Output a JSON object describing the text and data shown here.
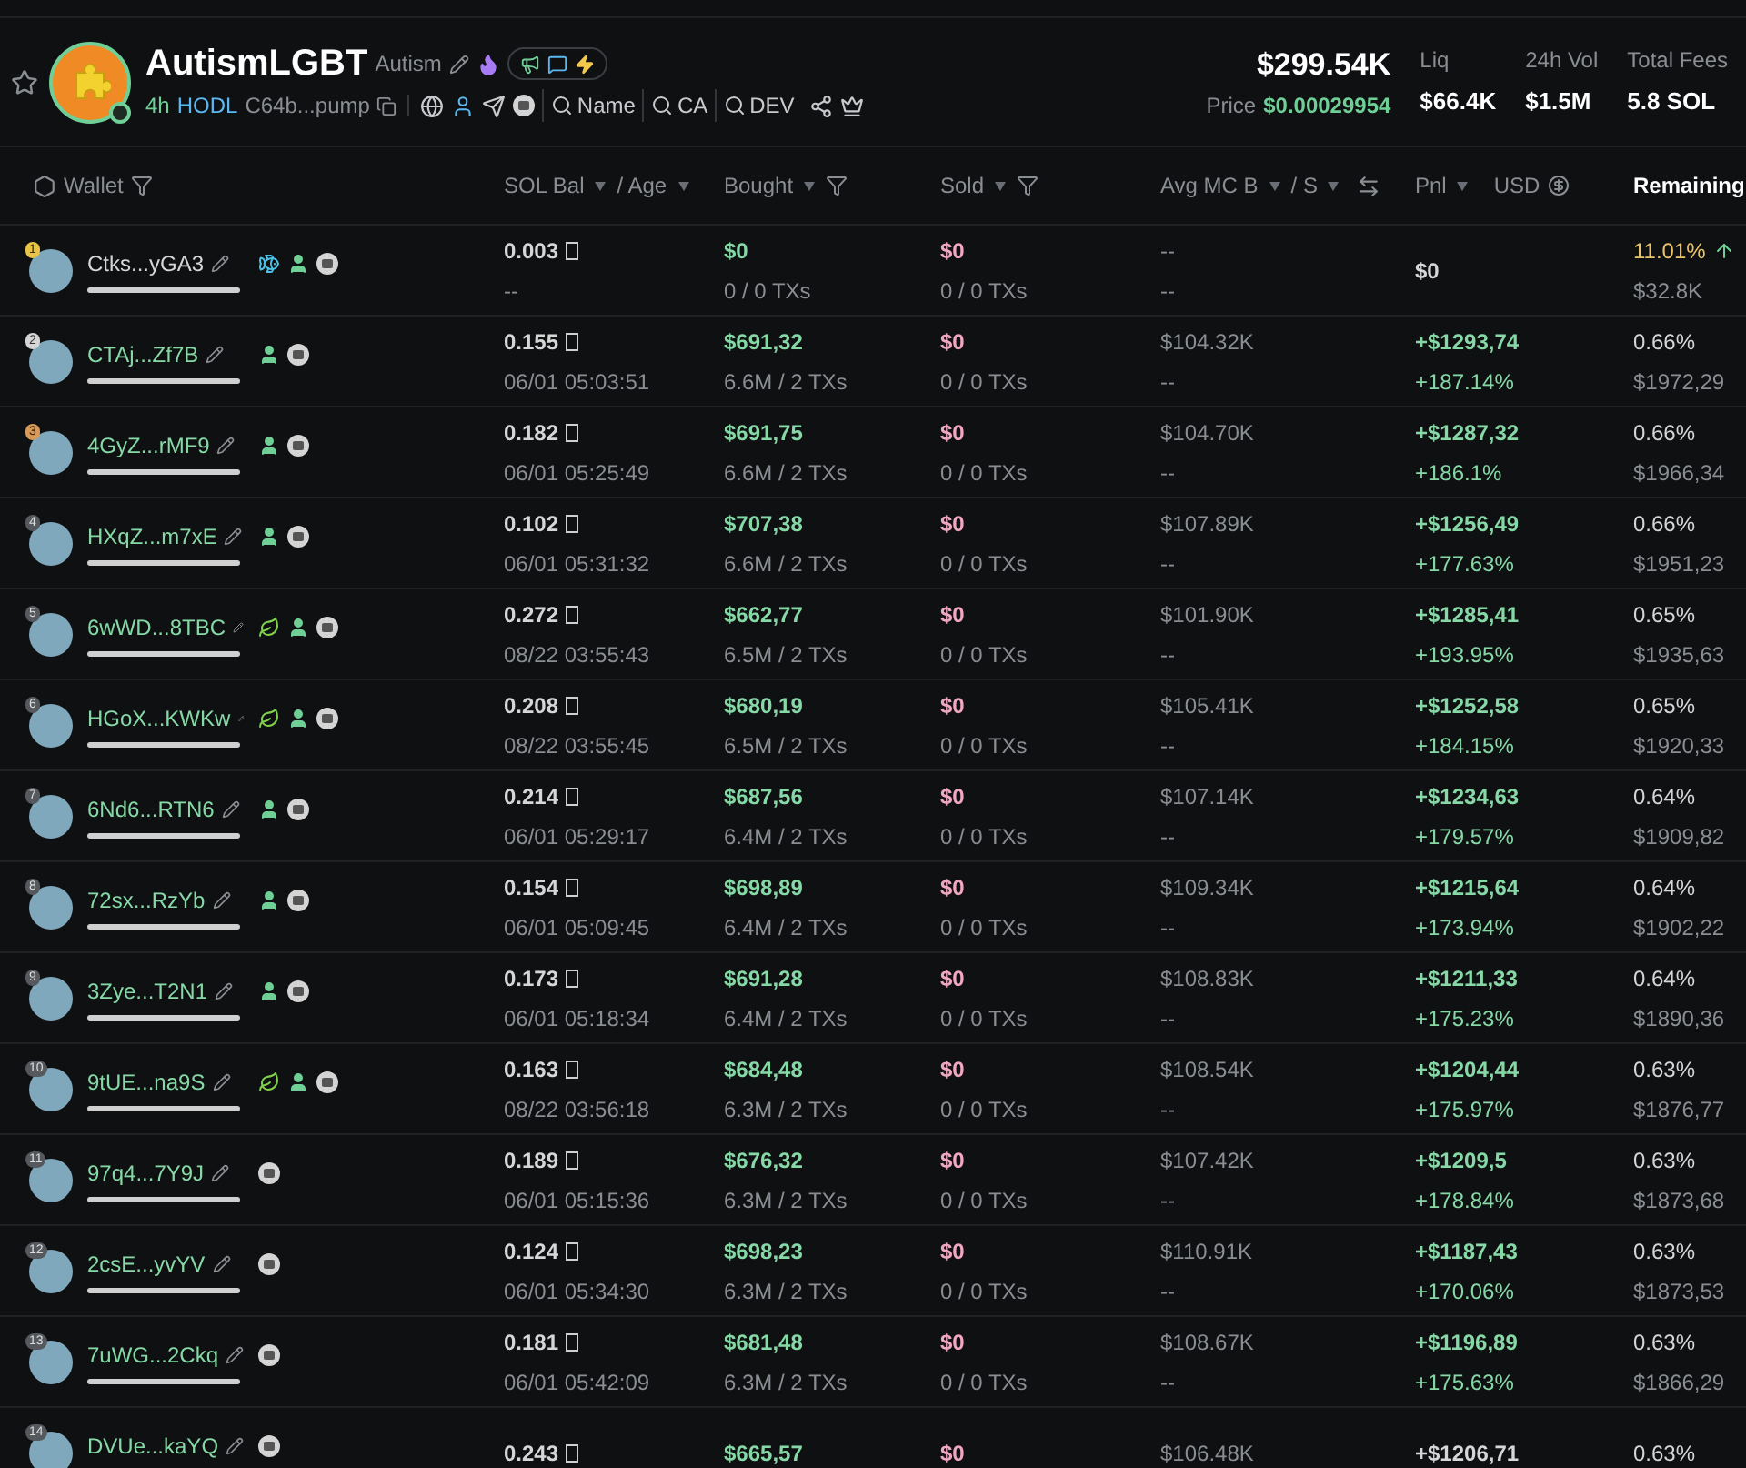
{
  "token": {
    "name": "AutismLGBT",
    "ticker": "Autism",
    "age": "4h",
    "tag": "HODL",
    "address": "C64b...pump",
    "market_cap": "$299.54K",
    "price_label": "Price",
    "price": "$0.00029954",
    "search_links": [
      "Name",
      "CA",
      "DEV"
    ],
    "stats": [
      {
        "label": "Liq",
        "value": "$66.4K"
      },
      {
        "label": "24h Vol",
        "value": "$1.5M"
      },
      {
        "label": "Total Fees",
        "value": "5.8 SOL"
      }
    ]
  },
  "columns": [
    {
      "kind": "wallet",
      "label": "Wallet",
      "selected": false
    },
    {
      "kind": "balance",
      "label": "SOL Bal",
      "label2": "/ Age",
      "selected": false
    },
    {
      "kind": "bought",
      "label": "Bought",
      "selected": false
    },
    {
      "kind": "sold",
      "label": "Sold",
      "selected": false
    },
    {
      "kind": "mc",
      "label": "Avg MC B",
      "label2": "/ S",
      "selected": false
    },
    {
      "kind": "pnl",
      "label": "Pnl",
      "label2": "USD",
      "selected": false
    },
    {
      "kind": "remaining",
      "label": "Remaining",
      "selected": true
    }
  ],
  "rows": [
    {
      "rank": "1",
      "wallet": "Ctks...yGA3",
      "highlight": true,
      "tags": [
        {
          "kind": "fish"
        },
        {
          "kind": "user"
        },
        {
          "kind": "coin"
        }
      ],
      "sol_bal": "0.003",
      "age": "--",
      "bought": "$0",
      "bought_txs": "0 / 0 TXs",
      "sold": "$0",
      "sold_txs": "0 / 0 TXs",
      "mc_buy": "--",
      "mc_sell": "--",
      "pnl": "$0",
      "remaining_pct": "11.01%",
      "remaining_value": "$32.8K"
    },
    {
      "rank": "2",
      "wallet": "CTAj...Zf7B",
      "highlight": false,
      "tags": [
        {
          "kind": "user"
        },
        {
          "kind": "coin"
        }
      ],
      "sol_bal": "0.155",
      "age": "06/01 05:03:51",
      "bought": "$691,32",
      "bought_txs": "6.6M / 2 TXs",
      "sold": "$0",
      "sold_txs": "0 / 0 TXs",
      "mc_buy": "$104.32K",
      "mc_sell": "--",
      "pnl": "+$1293,74",
      "pnl_pct": "+187.14%",
      "remaining_pct": "0.66%",
      "remaining_value": "$1972,29"
    },
    {
      "rank": "3",
      "wallet": "4GyZ...rMF9",
      "highlight": false,
      "tags": [
        {
          "kind": "user"
        },
        {
          "kind": "coin"
        }
      ],
      "sol_bal": "0.182",
      "age": "06/01 05:25:49",
      "bought": "$691,75",
      "bought_txs": "6.6M / 2 TXs",
      "sold": "$0",
      "sold_txs": "0 / 0 TXs",
      "mc_buy": "$104.70K",
      "mc_sell": "--",
      "pnl": "+$1287,32",
      "pnl_pct": "+186.1%",
      "remaining_pct": "0.66%",
      "remaining_value": "$1966,34"
    },
    {
      "rank": "4",
      "wallet": "HXqZ...m7xE",
      "highlight": false,
      "tags": [
        {
          "kind": "user"
        },
        {
          "kind": "coin"
        }
      ],
      "sol_bal": "0.102",
      "age": "06/01 05:31:32",
      "bought": "$707,38",
      "bought_txs": "6.6M / 2 TXs",
      "sold": "$0",
      "sold_txs": "0 / 0 TXs",
      "mc_buy": "$107.89K",
      "mc_sell": "--",
      "pnl": "+$1256,49",
      "pnl_pct": "+177.63%",
      "remaining_pct": "0.66%",
      "remaining_value": "$1951,23"
    },
    {
      "rank": "5",
      "wallet": "6wWD...8TBC",
      "highlight": false,
      "tags": [
        {
          "kind": "leaf"
        },
        {
          "kind": "user"
        },
        {
          "kind": "coin"
        }
      ],
      "sol_bal": "0.272",
      "age": "08/22 03:55:43",
      "bought": "$662,77",
      "bought_txs": "6.5M / 2 TXs",
      "sold": "$0",
      "sold_txs": "0 / 0 TXs",
      "mc_buy": "$101.90K",
      "mc_sell": "--",
      "pnl": "+$1285,41",
      "pnl_pct": "+193.95%",
      "remaining_pct": "0.65%",
      "remaining_value": "$1935,63"
    },
    {
      "rank": "6",
      "wallet": "HGoX...KWKw",
      "highlight": false,
      "tags": [
        {
          "kind": "leaf"
        },
        {
          "kind": "user"
        },
        {
          "kind": "coin"
        }
      ],
      "sol_bal": "0.208",
      "age": "08/22 03:55:45",
      "bought": "$680,19",
      "bought_txs": "6.5M / 2 TXs",
      "sold": "$0",
      "sold_txs": "0 / 0 TXs",
      "mc_buy": "$105.41K",
      "mc_sell": "--",
      "pnl": "+$1252,58",
      "pnl_pct": "+184.15%",
      "remaining_pct": "0.65%",
      "remaining_value": "$1920,33"
    },
    {
      "rank": "7",
      "wallet": "6Nd6...RTN6",
      "highlight": false,
      "tags": [
        {
          "kind": "user"
        },
        {
          "kind": "coin"
        }
      ],
      "sol_bal": "0.214",
      "age": "06/01 05:29:17",
      "bought": "$687,56",
      "bought_txs": "6.4M / 2 TXs",
      "sold": "$0",
      "sold_txs": "0 / 0 TXs",
      "mc_buy": "$107.14K",
      "mc_sell": "--",
      "pnl": "+$1234,63",
      "pnl_pct": "+179.57%",
      "remaining_pct": "0.64%",
      "remaining_value": "$1909,82"
    },
    {
      "rank": "8",
      "wallet": "72sx...RzYb",
      "highlight": false,
      "tags": [
        {
          "kind": "user"
        },
        {
          "kind": "coin"
        }
      ],
      "sol_bal": "0.154",
      "age": "06/01 05:09:45",
      "bought": "$698,89",
      "bought_txs": "6.4M / 2 TXs",
      "sold": "$0",
      "sold_txs": "0 / 0 TXs",
      "mc_buy": "$109.34K",
      "mc_sell": "--",
      "pnl": "+$1215,64",
      "pnl_pct": "+173.94%",
      "remaining_pct": "0.64%",
      "remaining_value": "$1902,22"
    },
    {
      "rank": "9",
      "wallet": "3Zye...T2N1",
      "highlight": false,
      "tags": [
        {
          "kind": "user"
        },
        {
          "kind": "coin"
        }
      ],
      "sol_bal": "0.173",
      "age": "06/01 05:18:34",
      "bought": "$691,28",
      "bought_txs": "6.4M / 2 TXs",
      "sold": "$0",
      "sold_txs": "0 / 0 TXs",
      "mc_buy": "$108.83K",
      "mc_sell": "--",
      "pnl": "+$1211,33",
      "pnl_pct": "+175.23%",
      "remaining_pct": "0.64%",
      "remaining_value": "$1890,36"
    },
    {
      "rank": "10",
      "wallet": "9tUE...na9S",
      "highlight": false,
      "tags": [
        {
          "kind": "leaf"
        },
        {
          "kind": "user"
        },
        {
          "kind": "coin"
        }
      ],
      "sol_bal": "0.163",
      "age": "08/22 03:56:18",
      "bought": "$684,48",
      "bought_txs": "6.3M / 2 TXs",
      "sold": "$0",
      "sold_txs": "0 / 0 TXs",
      "mc_buy": "$108.54K",
      "mc_sell": "--",
      "pnl": "+$1204,44",
      "pnl_pct": "+175.97%",
      "remaining_pct": "0.63%",
      "remaining_value": "$1876,77"
    },
    {
      "rank": "11",
      "wallet": "97q4...7Y9J",
      "highlight": false,
      "tags": [
        {
          "kind": "coin"
        }
      ],
      "sol_bal": "0.189",
      "age": "06/01 05:15:36",
      "bought": "$676,32",
      "bought_txs": "6.3M / 2 TXs",
      "sold": "$0",
      "sold_txs": "0 / 0 TXs",
      "mc_buy": "$107.42K",
      "mc_sell": "--",
      "pnl": "+$1209,5",
      "pnl_pct": "+178.84%",
      "remaining_pct": "0.63%",
      "remaining_value": "$1873,68"
    },
    {
      "rank": "12",
      "wallet": "2csE...yvYV",
      "highlight": false,
      "tags": [
        {
          "kind": "coin"
        }
      ],
      "sol_bal": "0.124",
      "age": "06/01 05:34:30",
      "bought": "$698,23",
      "bought_txs": "6.3M / 2 TXs",
      "sold": "$0",
      "sold_txs": "0 / 0 TXs",
      "mc_buy": "$110.91K",
      "mc_sell": "--",
      "pnl": "+$1187,43",
      "pnl_pct": "+170.06%",
      "remaining_pct": "0.63%",
      "remaining_value": "$1873,53"
    },
    {
      "rank": "13",
      "wallet": "7uWG...2Ckq",
      "highlight": false,
      "tags": [
        {
          "kind": "coin"
        }
      ],
      "sol_bal": "0.181",
      "age": "06/01 05:42:09",
      "bought": "$681,48",
      "bought_txs": "6.3M / 2 TXs",
      "sold": "$0",
      "sold_txs": "0 / 0 TXs",
      "mc_buy": "$108.67K",
      "mc_sell": "--",
      "pnl": "+$1196,89",
      "pnl_pct": "+175.63%",
      "remaining_pct": "0.63%",
      "remaining_value": "$1866,29"
    },
    {
      "rank": "14",
      "wallet": "DVUe...kaYQ",
      "highlight": false,
      "tags": [
        {
          "kind": "coin"
        }
      ],
      "sol_bal": "0.243",
      "bought": "$665,57",
      "sold": "$0",
      "mc_buy": "$106.48K",
      "pnl": "+$1206,71",
      "remaining_pct": "0.63%"
    }
  ]
}
